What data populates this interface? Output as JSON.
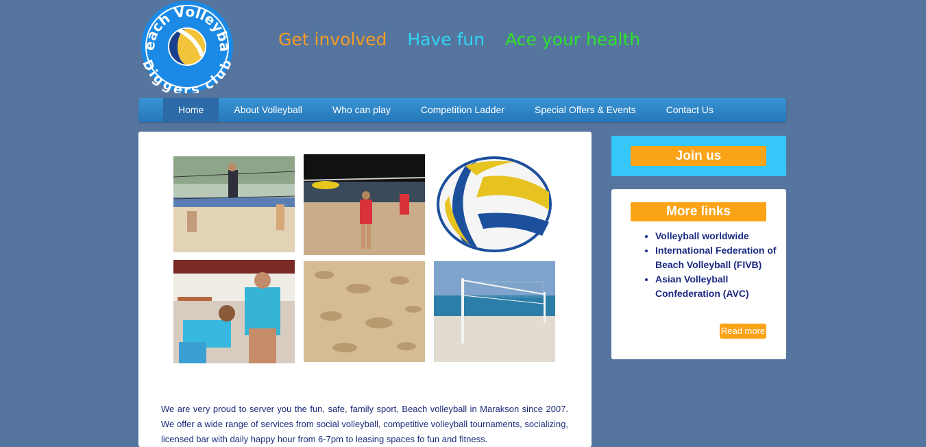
{
  "logo": {
    "top_text": "Beach Volleyball",
    "bottom_text": "Diggers club"
  },
  "taglines": [
    {
      "text": "Get involved",
      "color": "#f79c22"
    },
    {
      "text": "Have fun",
      "color": "#2ed6f6"
    },
    {
      "text": "Ace your health",
      "color": "#2ee22a"
    }
  ],
  "nav": {
    "items": [
      "Home",
      "About Volleyball",
      "Who can play",
      "Competition Ladder",
      "Special Offers & Events",
      "Contact Us"
    ],
    "active": "Home"
  },
  "main": {
    "photos": [
      "beach-volleyball-players-photo",
      "women-spiking-photo",
      "volleyball-ball-image",
      "players-ready-stance-photo",
      "sand-texture-photo",
      "beach-net-photo"
    ],
    "intro": "We are very proud to server you the fun, safe, family sport, Beach volleyball in Marakson since 2007. We offer a wide range of services from social volleyball, competitive volleyball tournaments, socializing, licensed bar with daily happy hour from 6-7pm to leasing spaces fo fun and fitness."
  },
  "sidebar": {
    "join_label": "Join us",
    "links_title": "More links",
    "links": [
      "Volleyball worldwide",
      "International Federation of Beach Volleyball (FIVB)",
      "Asian Volleyball Confederation (AVC)"
    ],
    "read_more": "Read more"
  },
  "colors": {
    "background": "#55759e",
    "nav": "#2f86c8",
    "accent_orange": "#fba317",
    "join_box": "#35c7f7"
  }
}
